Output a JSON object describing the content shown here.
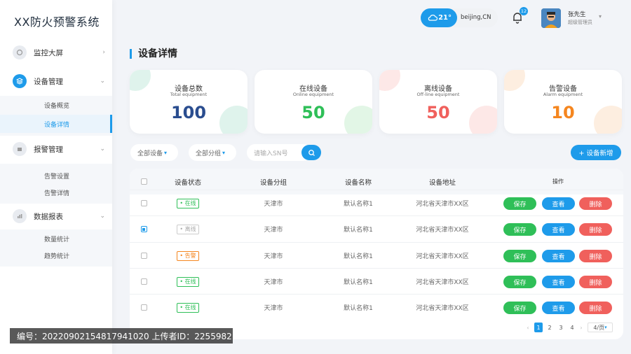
{
  "app_title": "XX防火预警系统",
  "sidebar": {
    "items": [
      {
        "label": "监控大屏"
      },
      {
        "label": "设备管理",
        "subs": [
          {
            "label": "设备概览"
          },
          {
            "label": "设备详情"
          }
        ]
      },
      {
        "label": "报警管理",
        "subs": [
          {
            "label": "告警设置"
          },
          {
            "label": "告警详情"
          }
        ]
      },
      {
        "label": "数据报表",
        "subs": [
          {
            "label": "数量统计"
          },
          {
            "label": "趋势统计"
          }
        ]
      }
    ]
  },
  "header": {
    "temperature": "21°",
    "city": "beijing,CN",
    "notifications": "12",
    "user_name": "张先生",
    "user_role": "超级管理员"
  },
  "page_title": "设备详情",
  "stats": [
    {
      "title": "设备总数",
      "subtitle": "Total equipment",
      "value": "100",
      "color": "#2a4d8f"
    },
    {
      "title": "在线设备",
      "subtitle": "Online equipment",
      "value": "50",
      "color": "#2fbf58"
    },
    {
      "title": "离线设备",
      "subtitle": "Off-line equipment",
      "value": "50",
      "color": "#f0605c"
    },
    {
      "title": "告警设备",
      "subtitle": "Alarm equipment",
      "value": "10",
      "color": "#f5861f"
    }
  ],
  "filters": {
    "all_devices": "全部设备",
    "all_groups": "全部分组",
    "search_placeholder": "请输入SN号",
    "add_button": "+ 设备新增"
  },
  "table": {
    "headers": [
      "设备状态",
      "设备分组",
      "设备名称",
      "设备地址",
      "操作"
    ],
    "rows": [
      {
        "status": "• 在线",
        "status_color": "#2fbf58",
        "group": "天津市",
        "name": "默认名称1",
        "address": "河北省天津市XX区",
        "checked": false
      },
      {
        "status": "• 离线",
        "status_color": "#aaaaaa",
        "group": "天津市",
        "name": "默认名称1",
        "address": "河北省天津市XX区",
        "checked": true
      },
      {
        "status": "• 告警",
        "status_color": "#f5861f",
        "group": "天津市",
        "name": "默认名称1",
        "address": "河北省天津市XX区",
        "checked": false
      },
      {
        "status": "• 在线",
        "status_color": "#2fbf58",
        "group": "天津市",
        "name": "默认名称1",
        "address": "河北省天津市XX区",
        "checked": false
      },
      {
        "status": "• 在线",
        "status_color": "#2fbf58",
        "group": "天津市",
        "name": "默认名称1",
        "address": "河北省天津市XX区",
        "checked": false
      }
    ],
    "actions": {
      "save": "保存",
      "view": "查看",
      "delete": "删除"
    }
  },
  "pagination": {
    "pages": [
      "1",
      "2",
      "3",
      "4"
    ],
    "page_size": "4/页"
  },
  "watermark": "编号：20220902154817941020 上传者ID：2255982"
}
